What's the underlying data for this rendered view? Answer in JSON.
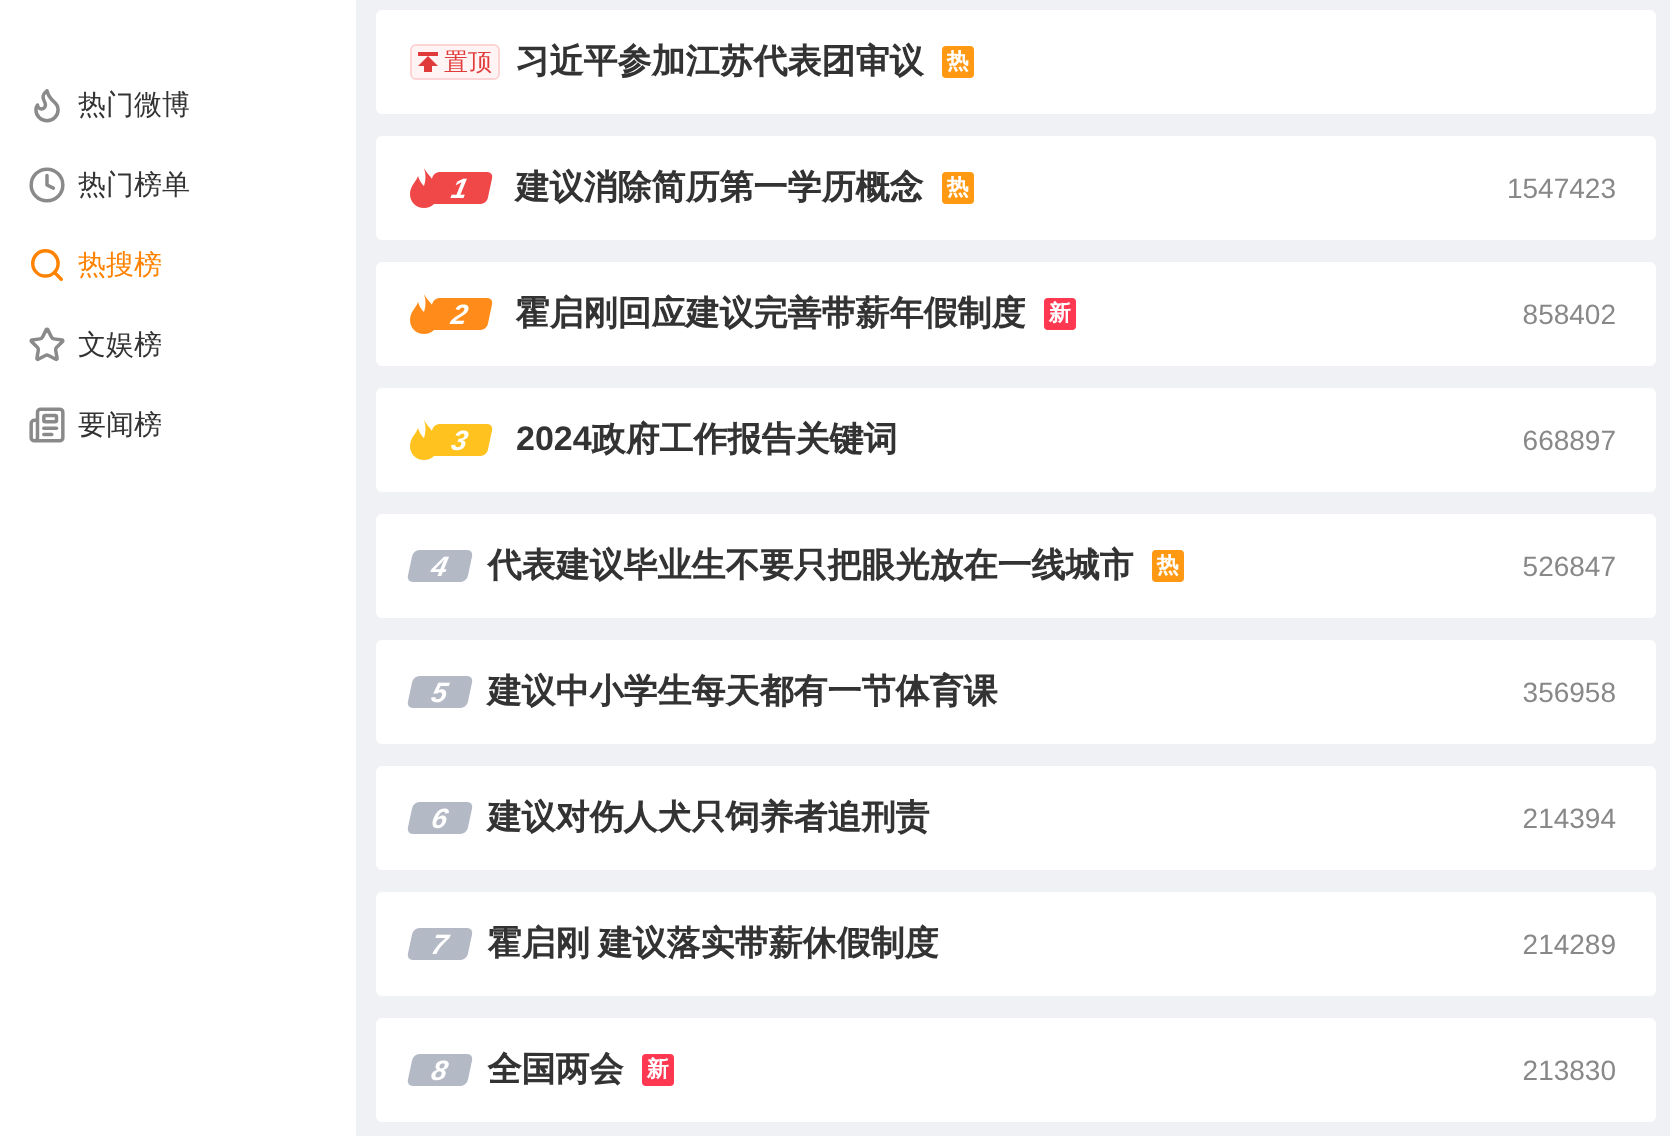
{
  "sidebar": {
    "items": [
      {
        "label": "热门微博",
        "selected": false
      },
      {
        "label": "热门榜单",
        "selected": false
      },
      {
        "label": "热搜榜",
        "selected": true
      },
      {
        "label": "文娱榜",
        "selected": false
      },
      {
        "label": "要闻榜",
        "selected": false
      }
    ]
  },
  "list": [
    {
      "kind": "pinned",
      "badge": "置顶",
      "title": "习近平参加江苏代表团审议",
      "tag": {
        "text": "热",
        "color": "#ff9812"
      }
    },
    {
      "kind": "top",
      "rank": "1",
      "color": "#f04848",
      "title": "建议消除简历第一学历概念",
      "tag": {
        "text": "热",
        "color": "#ff9812"
      },
      "count": "1547423"
    },
    {
      "kind": "top",
      "rank": "2",
      "color": "#ff8c1a",
      "title": "霍启刚回应建议完善带薪年假制度",
      "tag": {
        "text": "新",
        "color": "#ff3852"
      },
      "count": "858402"
    },
    {
      "kind": "top",
      "rank": "3",
      "color": "#ffc21f",
      "title": "2024政府工作报告关键词",
      "count": "668897"
    },
    {
      "kind": "normal",
      "rank": "4",
      "color": "#b4b9c6",
      "title": "代表建议毕业生不要只把眼光放在一线城市",
      "tag": {
        "text": "热",
        "color": "#ff9812"
      },
      "count": "526847"
    },
    {
      "kind": "normal",
      "rank": "5",
      "color": "#b4b9c6",
      "title": "建议中小学生每天都有一节体育课",
      "count": "356958"
    },
    {
      "kind": "normal",
      "rank": "6",
      "color": "#b4b9c6",
      "title": "建议对伤人犬只饲养者追刑责",
      "count": "214394"
    },
    {
      "kind": "normal",
      "rank": "7",
      "color": "#b4b9c6",
      "title": "霍启刚 建议落实带薪休假制度",
      "count": "214289"
    },
    {
      "kind": "normal",
      "rank": "8",
      "color": "#b4b9c6",
      "title": "全国两会",
      "tag": {
        "text": "新",
        "color": "#ff3852"
      },
      "count": "213830"
    }
  ]
}
